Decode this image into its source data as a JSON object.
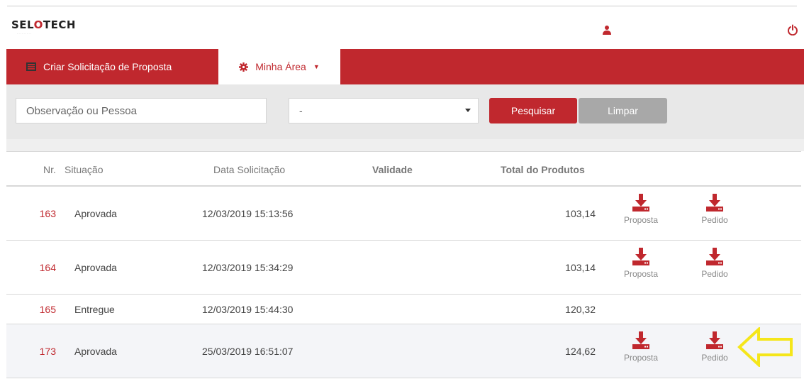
{
  "header": {
    "logo_text": "SELOTECH",
    "user_icon": "user-icon",
    "power_icon": "power-icon"
  },
  "nav": {
    "create_label": "Criar Solicitação de Proposta",
    "area_label": "Minha Área"
  },
  "filters": {
    "search_placeholder": "Observação ou Pessoa",
    "select_value": "-",
    "search_button": "Pesquisar",
    "clear_button": "Limpar"
  },
  "table": {
    "headers": {
      "nr": "Nr.",
      "situacao": "Situação",
      "data": "Data Solicitação",
      "validade": "Validade",
      "total": "Total do Produtos"
    },
    "rows": [
      {
        "nr": "163",
        "situacao": "Aprovada",
        "data": "12/03/2019 15:13:56",
        "validade": "",
        "total": "103,14",
        "proposta": "Proposta",
        "pedido": "Pedido"
      },
      {
        "nr": "164",
        "situacao": "Aprovada",
        "data": "12/03/2019 15:34:29",
        "validade": "",
        "total": "103,14",
        "proposta": "Proposta",
        "pedido": "Pedido"
      },
      {
        "nr": "165",
        "situacao": "Entregue",
        "data": "12/03/2019 15:44:30",
        "validade": "",
        "total": "120,32"
      },
      {
        "nr": "173",
        "situacao": "Aprovada",
        "data": "25/03/2019 16:51:07",
        "validade": "",
        "total": "124,62",
        "proposta": "Proposta",
        "pedido": "Pedido"
      }
    ]
  },
  "colors": {
    "brand": "#c0282e",
    "clear_button": "#a8a8a8",
    "annotation_arrow": "#f5e61a"
  }
}
